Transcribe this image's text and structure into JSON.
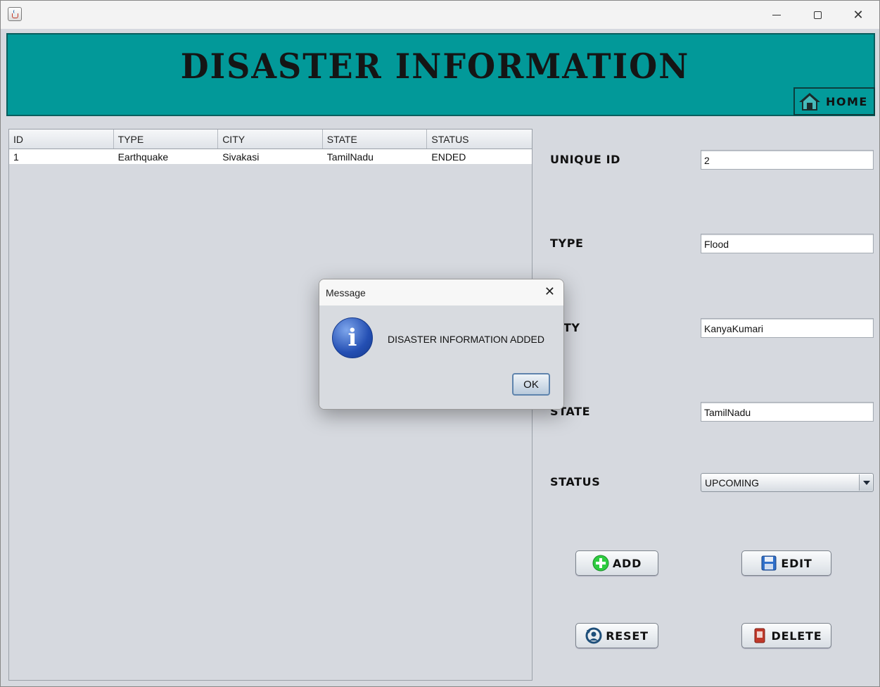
{
  "window": {
    "title": ""
  },
  "header": {
    "title": "DISASTER INFORMATION",
    "home_label": "HOME"
  },
  "table": {
    "columns": [
      "ID",
      "TYPE",
      "CITY",
      "STATE",
      "STATUS"
    ],
    "rows": [
      [
        "1",
        "Earthquake",
        "Sivakasi",
        "TamilNadu",
        "ENDED"
      ]
    ]
  },
  "form": {
    "unique_id": {
      "label": "UNIQUE ID",
      "value": "2"
    },
    "type": {
      "label": "TYPE",
      "value": "Flood"
    },
    "city": {
      "label": "CITY",
      "value": "KanyaKumari"
    },
    "state": {
      "label": "STATE",
      "value": "TamilNadu"
    },
    "status": {
      "label": "STATUS",
      "value": "UPCOMING"
    }
  },
  "buttons": {
    "add": "ADD",
    "edit": "EDIT",
    "reset": "RESET",
    "delete": "DELETE"
  },
  "dialog": {
    "title": "Message",
    "message": "DISASTER INFORMATION ADDED",
    "ok_label": "OK",
    "icon": "info-icon"
  },
  "colors": {
    "banner": "#029999",
    "background": "#d6d9df",
    "add_icon": "#2ecc40",
    "delete_icon": "#c0392b",
    "edit_icon": "#2f6fc9"
  }
}
